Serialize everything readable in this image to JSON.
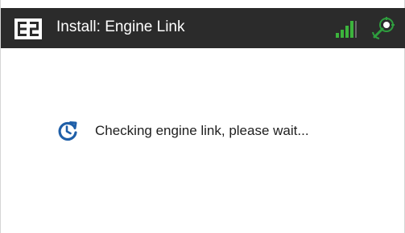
{
  "window": {
    "title": "Install: Engine Link"
  },
  "icons": {
    "app_logo": "app-logo-icon",
    "signal": "signal-strength-icon",
    "gps": "gps-location-icon",
    "progress": "refresh-spinner-icon"
  },
  "status": {
    "message": "Checking engine link, please wait..."
  },
  "colors": {
    "titlebar_bg": "#2b2b2b",
    "title_text": "#ffffff",
    "signal_green": "#3cb43c",
    "gps_green": "#2e9e3e",
    "spinner_blue": "#1f5fa8",
    "body_text": "#202020",
    "background": "#ffffff"
  }
}
